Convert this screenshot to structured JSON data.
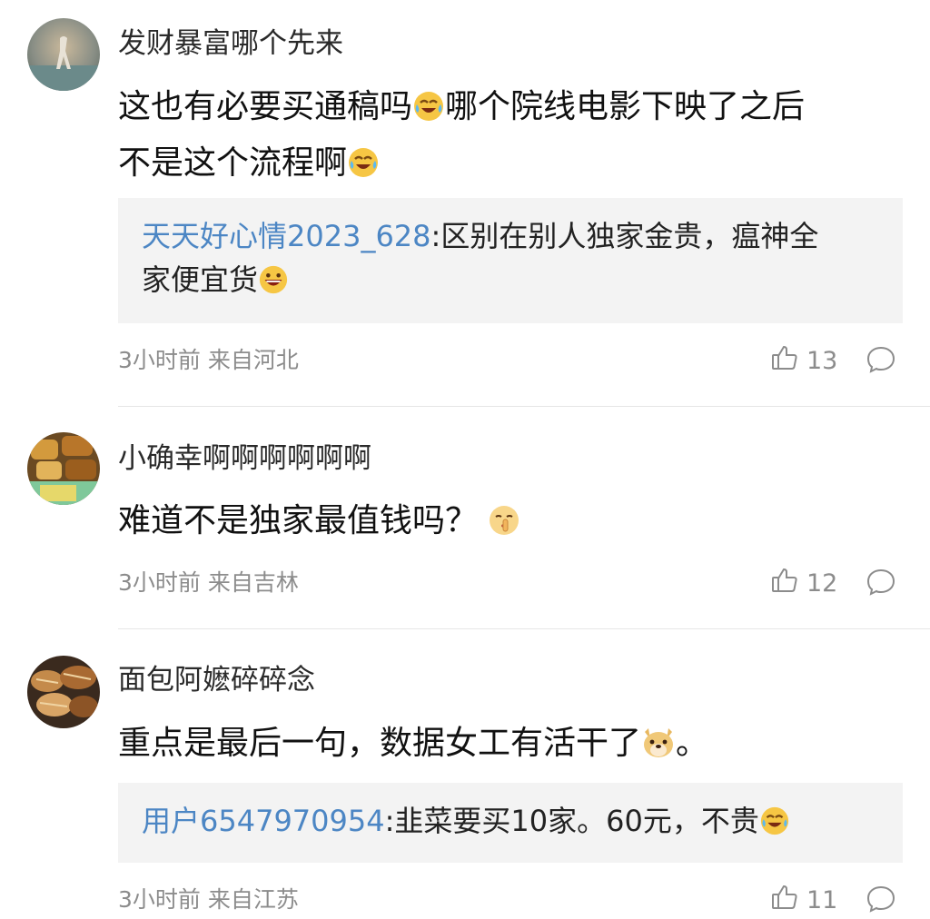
{
  "comments": [
    {
      "username": "发财暴富哪个先来",
      "text_line1": "这也有必要买通稿吗",
      "text_line1b": "哪个院线电影下映了之后",
      "text_line2": "不是这个流程啊",
      "emoji1": "laugh-cry-emoji",
      "emoji2": "laugh-cry-emoji",
      "reply": {
        "user": "天天好心情2023_628",
        "text_a": ":区别在别人独家金贵，瘟神全",
        "text_b": "家便宜货",
        "emoji": "grin-emoji"
      },
      "meta": "3小时前 来自河北",
      "likes": "13"
    },
    {
      "username": "小确幸啊啊啊啊啊啊",
      "text": "难道不是独家最值钱吗？",
      "emoji": "shush-emoji",
      "meta": "3小时前 来自吉林",
      "likes": "12"
    },
    {
      "username": "面包阿嬷碎碎念",
      "text_a": "重点是最后一句，数据女工有活干了",
      "text_b": "。",
      "emoji": "doge-emoji",
      "reply": {
        "user": "用户6547970954",
        "text": ":韭菜要买10家。60元，不贵",
        "emoji": "laugh-cry-emoji"
      },
      "meta": "3小时前 来自江苏",
      "likes": "11"
    }
  ],
  "icons": {
    "like": "thumbs-up-icon",
    "reply": "speech-bubble-icon"
  },
  "colors": {
    "link": "#4c86c4",
    "meta": "#8c8c8c",
    "reply_bg": "#f3f3f3"
  }
}
